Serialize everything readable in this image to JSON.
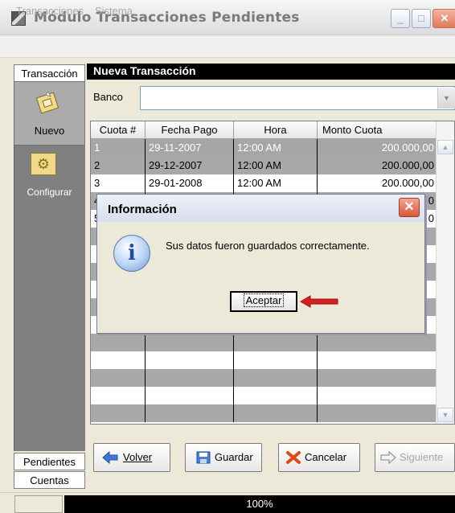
{
  "window": {
    "title": "Módulo Transacciones Pendientes",
    "controls": {
      "minimize": "_",
      "maximize": "□",
      "close": "✕"
    }
  },
  "menu": {
    "items": [
      "Transacciones",
      "Sistema"
    ]
  },
  "nav": {
    "tab_active": "Transacción",
    "items": [
      {
        "label": "Nuevo",
        "icon": "new-transaction-icon"
      },
      {
        "label": "Configurar",
        "icon": "configure-icon"
      }
    ],
    "bottom_tabs": [
      "Pendientes",
      "Cuentas"
    ]
  },
  "panel": {
    "header": "Nueva Transacción",
    "banco_label": "Banco",
    "banco_value": ""
  },
  "grid": {
    "columns": [
      "Cuota #",
      "Fecha Pago",
      "Hora",
      "Monto Cuota"
    ],
    "rows": [
      {
        "cuota": "1",
        "fecha": "29-11-2007",
        "hora": "12:00 AM",
        "monto": "200.000,00",
        "selected": true
      },
      {
        "cuota": "2",
        "fecha": "29-12-2007",
        "hora": "12:00 AM",
        "monto": "200.000,00"
      },
      {
        "cuota": "3",
        "fecha": "29-01-2008",
        "hora": "12:00 AM",
        "monto": "200.000,00"
      },
      {
        "cuota": "4",
        "fecha": "",
        "hora": "",
        "monto": "0"
      },
      {
        "cuota": "5",
        "fecha": "",
        "hora": "",
        "monto": "0"
      }
    ]
  },
  "buttons": {
    "volver": "Volver",
    "guardar": "Guardar",
    "cancelar": "Cancelar",
    "siguiente": "Siguiente"
  },
  "status": {
    "progress": "100%"
  },
  "dialog": {
    "title": "Información",
    "message": "Sus datos fueron guardados correctamente.",
    "ok": "Aceptar",
    "close": "✕"
  },
  "colors": {
    "nav_panel": "#808080",
    "header_bar": "#000000",
    "selected_row": "#a6a6a6",
    "arrow": "#d42020"
  }
}
